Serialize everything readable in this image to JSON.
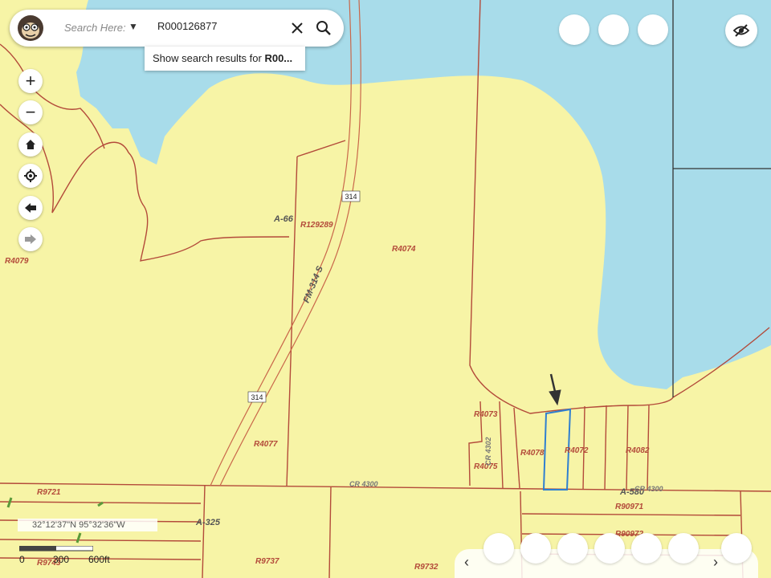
{
  "search": {
    "hint": "Search Here:",
    "dropdown_icon": "caret-down",
    "query": "R000126877",
    "suggestion_prefix": "Show search results for ",
    "suggestion_bold": "R00..."
  },
  "controls": {
    "zoom_in": "+",
    "zoom_out": "−"
  },
  "map_labels": {
    "r4079": "R4079",
    "a66": "A-66",
    "r129289": "R129289",
    "r4074": "R4074",
    "fm314": "FM-314 S",
    "shield314a": "314",
    "shield314b": "314",
    "r4077": "R4077",
    "r4073": "R4073",
    "r4075": "R4075",
    "r4078": "R4078",
    "r4072": "R4072",
    "r4082": "R4082",
    "cr4302": "CR 4302",
    "cr4300": "CR 4300",
    "a580": "A-580",
    "cr4300b": "CR 4300",
    "r9721": "R9721",
    "a325": "A-325",
    "r9743": "R9743",
    "r9737": "R9737",
    "r9732": "R9732",
    "r90971": "R90971",
    "r90972": "R90972"
  },
  "coordinates": "32°12'37\"N 95°32'36\"W",
  "scale": {
    "zero": "0",
    "mid": "300",
    "end": "600ft"
  },
  "carousel": {
    "prev": "‹",
    "next": "›"
  },
  "colors": {
    "land": "#f7f4a6",
    "water": "#a8dcea",
    "parcel": "#b34a3a",
    "highlight": "#2f7fd0"
  }
}
